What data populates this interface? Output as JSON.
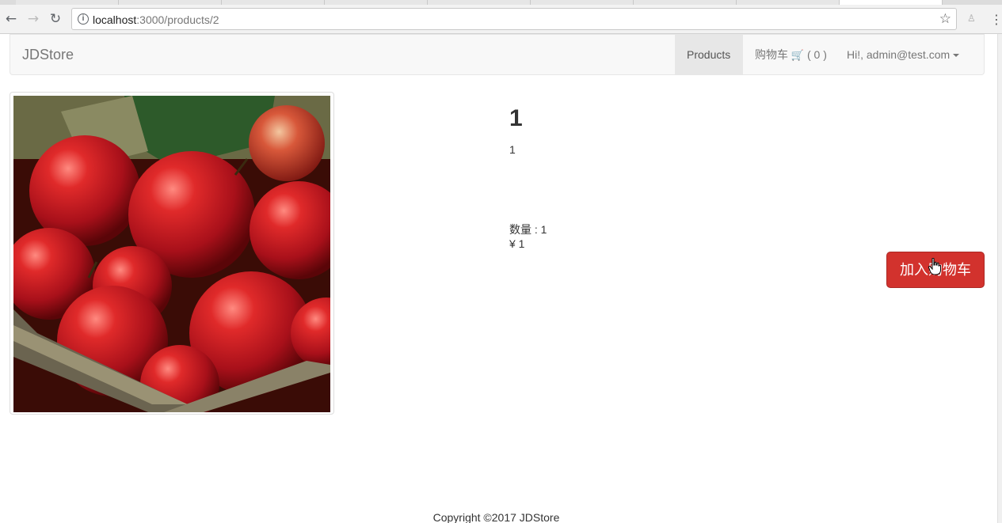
{
  "browser": {
    "url_host": "localhost",
    "url_rest": ":3000/products/2"
  },
  "navbar": {
    "brand": "JDStore",
    "items": [
      {
        "label": "Products"
      },
      {
        "label": "购物车",
        "cart_count": "( 0 )"
      },
      {
        "label": "Hi!, admin@test.com"
      }
    ]
  },
  "product": {
    "title": "1",
    "description": "1",
    "quantity": "数量 : 1",
    "price": "¥ 1",
    "add_to_cart": "加入购物车"
  },
  "footer": {
    "copyright": "Copyright ©2017 JDStore"
  },
  "colors": {
    "primary_button": "#d2322d",
    "navbar_bg": "#f8f8f8"
  }
}
